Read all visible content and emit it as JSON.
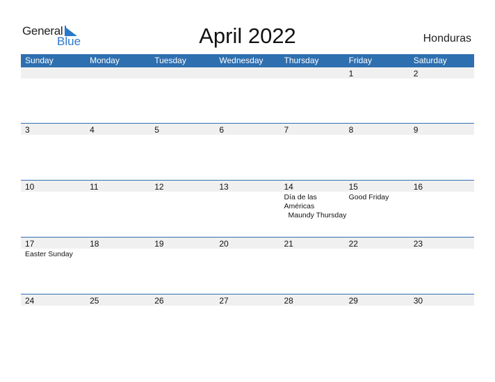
{
  "logo": {
    "text1": "General",
    "text2": "Blue"
  },
  "title": "April 2022",
  "country": "Honduras",
  "colors": {
    "accent": "#2e6faf",
    "band": "#f0f0f0",
    "logo_blue": "#2a78c8"
  },
  "weekdays": [
    "Sunday",
    "Monday",
    "Tuesday",
    "Wednesday",
    "Thursday",
    "Friday",
    "Saturday"
  ],
  "weeks": [
    [
      {
        "d": ""
      },
      {
        "d": ""
      },
      {
        "d": ""
      },
      {
        "d": ""
      },
      {
        "d": ""
      },
      {
        "d": "1"
      },
      {
        "d": "2"
      }
    ],
    [
      {
        "d": "3"
      },
      {
        "d": "4"
      },
      {
        "d": "5"
      },
      {
        "d": "6"
      },
      {
        "d": "7"
      },
      {
        "d": "8"
      },
      {
        "d": "9"
      }
    ],
    [
      {
        "d": "10"
      },
      {
        "d": "11"
      },
      {
        "d": "12"
      },
      {
        "d": "13"
      },
      {
        "d": "14",
        "events": [
          "Día de las Américas",
          "Maundy Thursday"
        ]
      },
      {
        "d": "15",
        "events": [
          "Good Friday"
        ]
      },
      {
        "d": "16"
      }
    ],
    [
      {
        "d": "17",
        "events": [
          "Easter Sunday"
        ]
      },
      {
        "d": "18"
      },
      {
        "d": "19"
      },
      {
        "d": "20"
      },
      {
        "d": "21"
      },
      {
        "d": "22"
      },
      {
        "d": "23"
      }
    ],
    [
      {
        "d": "24"
      },
      {
        "d": "25"
      },
      {
        "d": "26"
      },
      {
        "d": "27"
      },
      {
        "d": "28"
      },
      {
        "d": "29"
      },
      {
        "d": "30"
      }
    ]
  ]
}
